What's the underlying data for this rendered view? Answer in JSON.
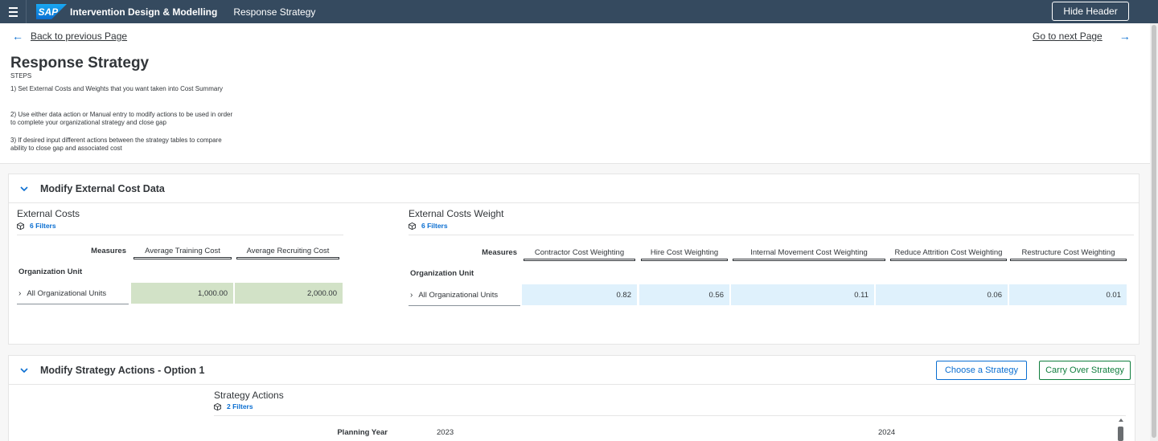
{
  "shell": {
    "logo_text": "SAP",
    "app_title": "Intervention Design & Modelling",
    "page_name": "Response Strategy",
    "hide_header_label": "Hide Header",
    "menu_icon": "hamburger-menu-icon",
    "colors": {
      "shell_bg": "#354a5f",
      "accent": "#0a6ed1"
    }
  },
  "nav": {
    "back_label": "Back to previous Page",
    "next_label": "Go to next Page",
    "back_icon": "arrow-left-icon",
    "next_icon": "arrow-right-icon"
  },
  "header": {
    "title": "Response Strategy",
    "steps_label": "STEPS",
    "steps": [
      "1) Set External Costs and Weights that you want taken into Cost Summary",
      "2) Use either data action or Manual entry to modify actions to be used in order to complete your organizational strategy and close gap",
      "3) If desired input different actions between the strategy tables to compare ability to close gap and associated cost"
    ]
  },
  "external_cost_panel": {
    "title": "Modify External Cost Data",
    "external_costs": {
      "title": "External Costs",
      "filters_label": "6 Filters",
      "measures_label": "Measures",
      "row_dimension_label": "Organization Unit",
      "columns": [
        "Average Training Cost",
        "Average Recruiting Cost"
      ],
      "rows": [
        {
          "label": "All Organizational Units",
          "values": [
            "1,000.00",
            "2,000.00"
          ]
        }
      ],
      "cell_color": "#d2e2c7"
    },
    "external_costs_weight": {
      "title": "External Costs Weight",
      "filters_label": "6 Filters",
      "measures_label": "Measures",
      "row_dimension_label": "Organization Unit",
      "columns": [
        "Contractor Cost Weighting",
        "Hire Cost Weighting",
        "Internal Movement Cost Weighting",
        "Reduce Attrition Cost Weighting",
        "Restructure Cost Weighting"
      ],
      "rows": [
        {
          "label": "All Organizational Units",
          "values": [
            "0.82",
            "0.56",
            "0.11",
            "0.06",
            "0.01"
          ]
        }
      ],
      "cell_color": "#dff1fc"
    }
  },
  "strategy_panel": {
    "title": "Modify Strategy Actions - Option 1",
    "choose_label": "Choose a Strategy",
    "carry_over_label": "Carry Over Strategy",
    "strategy_actions": {
      "title": "Strategy Actions",
      "filters_label": "2 Filters",
      "planning_year_label": "Planning Year",
      "years": [
        "2023",
        "2024"
      ]
    }
  }
}
